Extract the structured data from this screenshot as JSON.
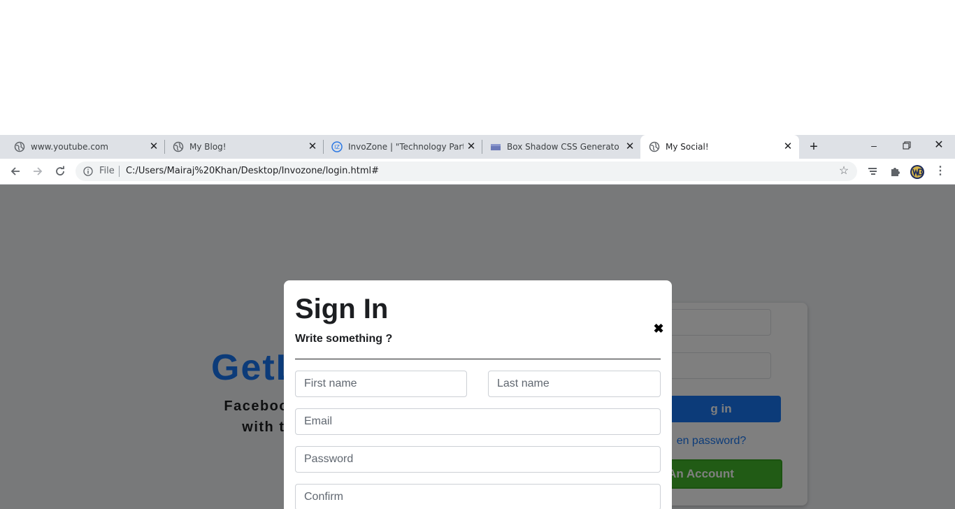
{
  "browser": {
    "tabs": [
      {
        "title": "www.youtube.com",
        "icon": "globe-icon"
      },
      {
        "title": "My Blog!",
        "icon": "globe-icon"
      },
      {
        "title": "InvoZone | \"Technology Partner",
        "icon": "invozone-logo-icon"
      },
      {
        "title": "Box Shadow CSS Generator | C",
        "icon": "page-icon"
      },
      {
        "title": "My Social!",
        "icon": "globe-icon"
      }
    ],
    "address_scheme": "File",
    "address_url": "C:/Users/Mairaj%20Khan/Desktop/Invozone/login.html#"
  },
  "page": {
    "hero_title": "GetL",
    "hero_line1": "Facebook helps you",
    "hero_line2": "with the peopl",
    "login_button": "g in",
    "forgot_link": "en password?",
    "create_button": "An Account"
  },
  "modal": {
    "title": "Sign In",
    "subtitle": "Write something ?",
    "close_symbol": "✖",
    "first_name_placeholder": "First name",
    "last_name_placeholder": "Last name",
    "email_placeholder": "Email",
    "password_placeholder": "Password",
    "confirm_placeholder": "Confirm"
  },
  "colors": {
    "accent": "#1877f2",
    "success": "#42b72a",
    "tabstrip": "#dee1e6"
  }
}
